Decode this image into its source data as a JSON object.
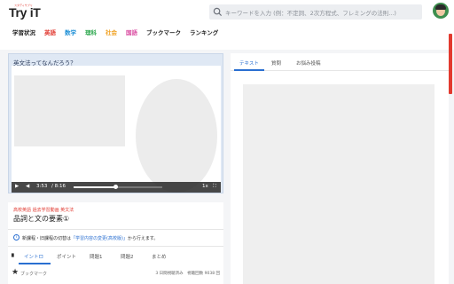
{
  "header": {
    "logo_small": "スタディサプリ",
    "logo": "Try iT",
    "search_placeholder": "キーワードを入力 (例：不定詞、2次方程式、フレミングの法則...)"
  },
  "nav": [
    {
      "label": "学習状況",
      "color": "#222222"
    },
    {
      "label": "英語",
      "color": "#e0382f"
    },
    {
      "label": "数学",
      "color": "#1e90d6"
    },
    {
      "label": "理科",
      "color": "#2fa84f"
    },
    {
      "label": "社会",
      "color": "#f0a020"
    },
    {
      "label": "国語",
      "color": "#d94aa0"
    },
    {
      "label": "ブックマーク",
      "color": "#222222"
    },
    {
      "label": "ランキング",
      "color": "#222222"
    }
  ],
  "video": {
    "title": "英文法ってなんだろう？",
    "time_current": "3:53",
    "time_total": "/ 8:16",
    "progress": 0.47,
    "speed": "1x"
  },
  "lesson": {
    "subtitle": "高校英語 過去学習動画 英文法",
    "title": "品詞と文の要素①",
    "notice_prefix": "新課程・旧課程の切替は",
    "notice_link": "「学習内容の変更(高校版)」",
    "notice_suffix": "から行えます。",
    "tabs": [
      "イントロ",
      "ポイント",
      "問題1",
      "問題2",
      "まとめ"
    ],
    "bookmark_label": "ブックマーク",
    "stats": "3 日間視聴済み　視聴回数 9038 回"
  },
  "right_panel": {
    "tabs": [
      "テキスト",
      "質問",
      "お悩み投稿"
    ]
  }
}
